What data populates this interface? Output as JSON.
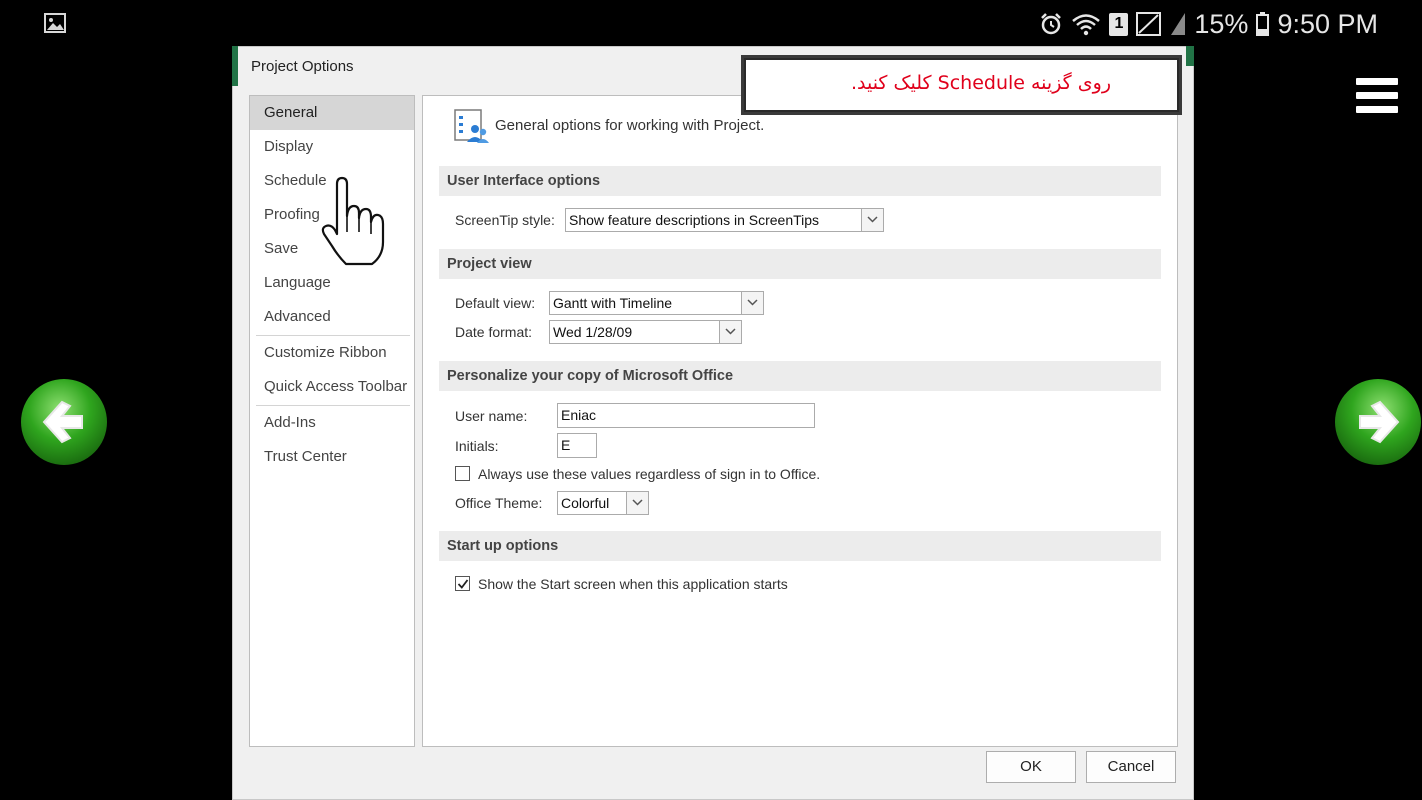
{
  "status_bar": {
    "battery_percent": "15%",
    "time": "9:50 PM",
    "sim_slot": "1",
    "icons": [
      "gallery-icon",
      "alarm-icon",
      "wifi-icon",
      "sim-icon",
      "no-signal-icon",
      "signal-icon",
      "battery-icon"
    ]
  },
  "callout": {
    "text": "روی گزینه Schedule کلیک کنید."
  },
  "dialog": {
    "title": "Project Options",
    "categories": [
      {
        "label": "General",
        "selected": true
      },
      {
        "label": "Display"
      },
      {
        "label": "Schedule"
      },
      {
        "label": "Proofing"
      },
      {
        "label": "Save"
      },
      {
        "label": "Language"
      },
      {
        "label": "Advanced"
      },
      {
        "label": "Customize Ribbon"
      },
      {
        "label": "Quick Access Toolbar"
      },
      {
        "label": "Add-Ins"
      },
      {
        "label": "Trust Center"
      }
    ],
    "header_text": "General options for working with Project.",
    "sections": {
      "ui_options": "User Interface options",
      "project_view": "Project view",
      "personalize": "Personalize your copy of Microsoft Office",
      "startup": "Start up options"
    },
    "screentip": {
      "label": "ScreenTip style:",
      "value": "Show feature descriptions in ScreenTips"
    },
    "default_view": {
      "label": "Default view:",
      "value": "Gantt with Timeline"
    },
    "date_format": {
      "label": "Date format:",
      "value": "Wed 1/28/09"
    },
    "user_name": {
      "label": "User name:",
      "value": "Eniac"
    },
    "initials": {
      "label": "Initials:",
      "value": "E"
    },
    "always_use": {
      "label": "Always use these values regardless of sign in to Office.",
      "checked": false
    },
    "office_theme": {
      "label": "Office Theme:",
      "value": "Colorful"
    },
    "show_start": {
      "label": "Show the Start screen when this application starts",
      "checked": true
    },
    "ok_label": "OK",
    "cancel_label": "Cancel"
  },
  "colors": {
    "accent_green": "#217346",
    "callout_red": "#e0001b",
    "nav_arrow_green": "#2fa51e"
  }
}
